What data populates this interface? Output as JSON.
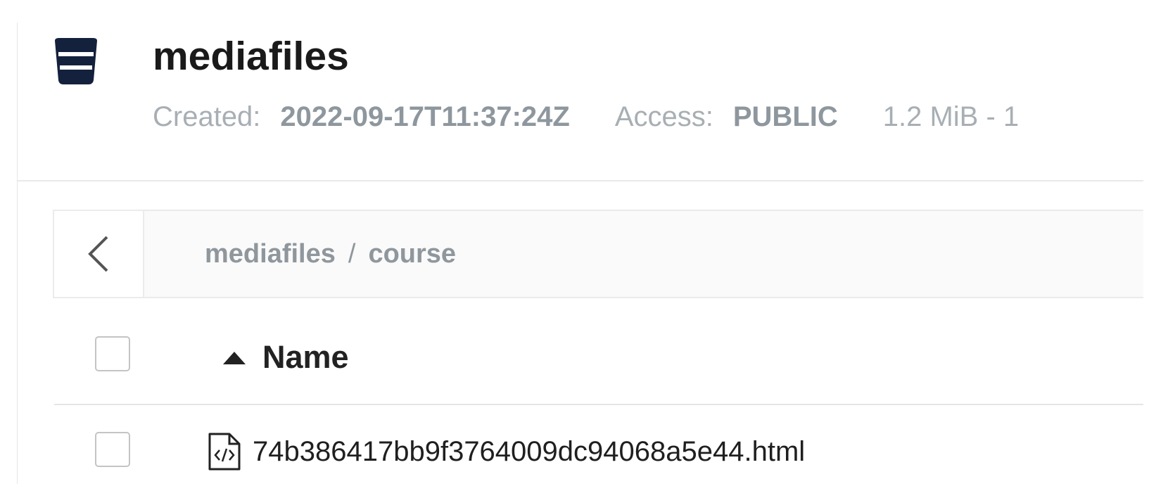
{
  "bucket": {
    "name": "mediafiles",
    "icon": "bucket-icon",
    "created_label": "Created:",
    "created_value": "2022-09-17T11:37:24Z",
    "access_label": "Access:",
    "access_value": "PUBLIC",
    "size_summary": "1.2 MiB - 1"
  },
  "breadcrumb": {
    "back_icon": "chevron-left-icon",
    "items": [
      "mediafiles",
      "course"
    ],
    "separator": "/"
  },
  "table": {
    "columns": [
      {
        "label": "Name",
        "sort": "ascending",
        "sort_icon": "sort-up-icon"
      }
    ],
    "rows": [
      {
        "name": "74b386417bb9f3764009dc94068a5e44.html",
        "icon": "html-file-icon",
        "selected": false
      }
    ]
  },
  "colors": {
    "icon_dark": "#14213d",
    "muted_text": "#9aa3aa",
    "border": "#ebebeb"
  }
}
